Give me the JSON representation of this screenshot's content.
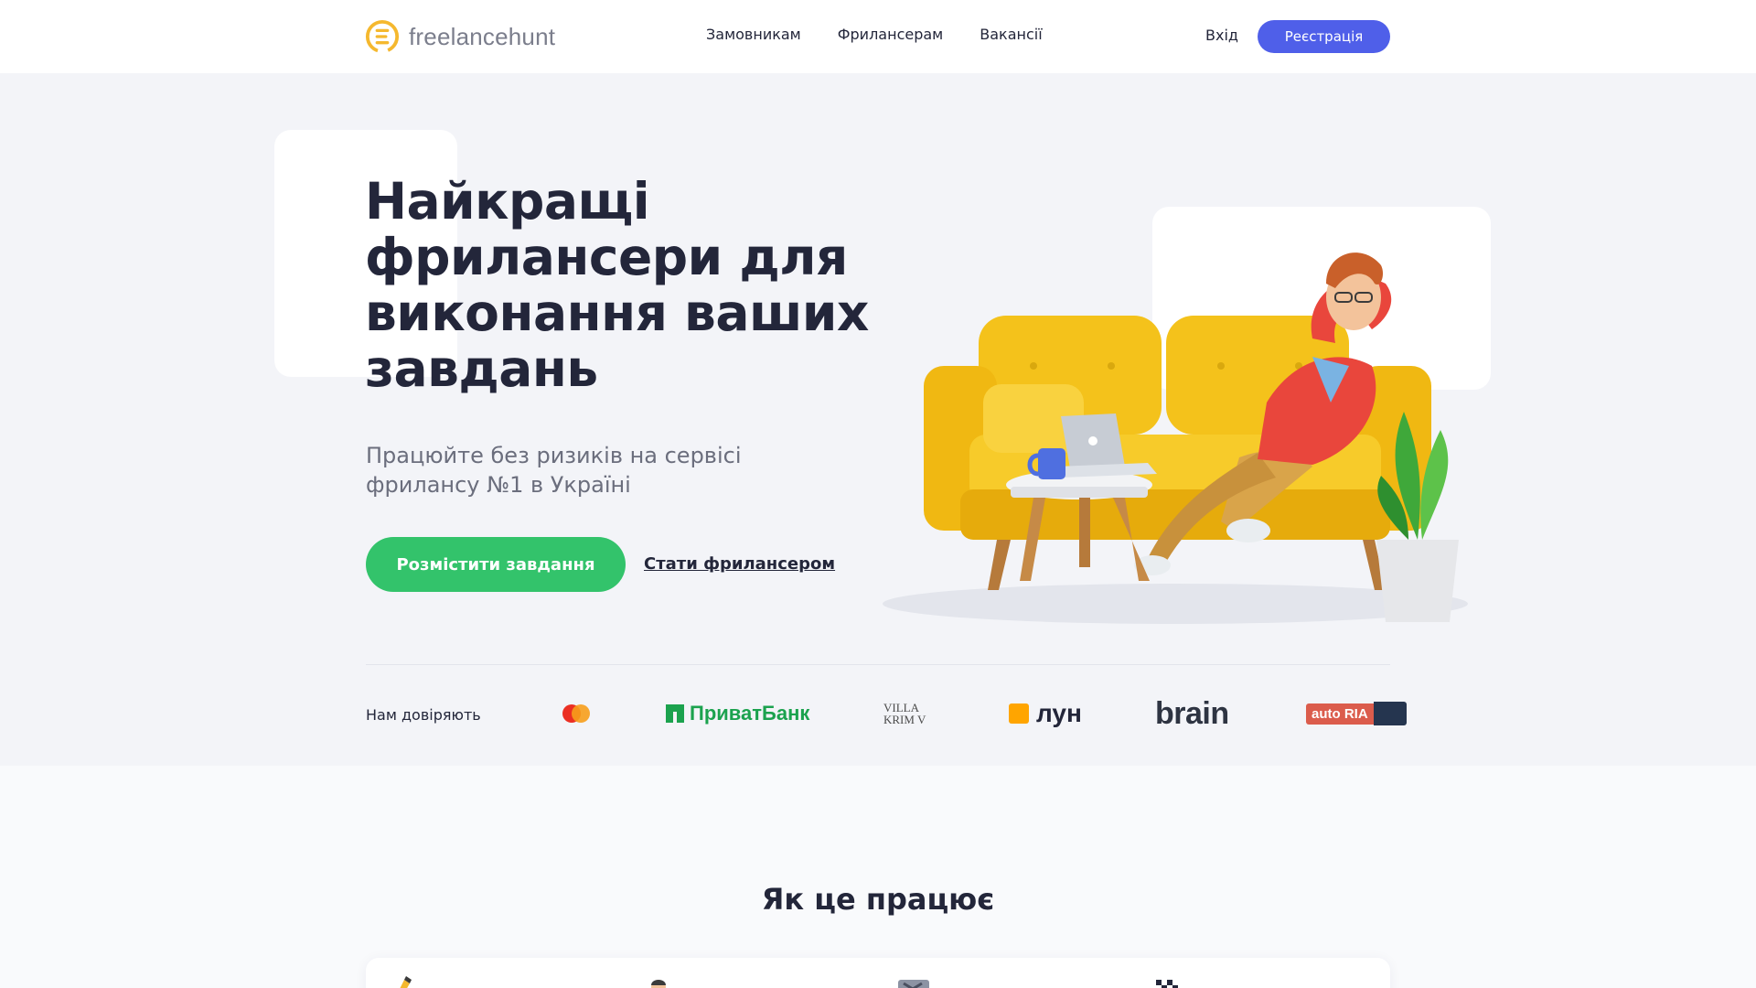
{
  "header": {
    "logo_text": "freelancehunt",
    "nav": [
      "Замовникам",
      "Фрилансерам",
      "Вакансії"
    ],
    "login_label": "Вхід",
    "register_label": "Реєстрація"
  },
  "hero": {
    "title": "Найкращі фрилансери для виконання ваших завдань",
    "subtitle": "Працюйте без ризиків на сервісі фрилансу №1 в Україні",
    "primary_button": "Розмістити завдання",
    "secondary_link": "Стати фрилансером"
  },
  "trust": {
    "label": "Нам довіряють",
    "logos": [
      {
        "name": "mastercard",
        "text": ""
      },
      {
        "name": "privatbank",
        "text": "ПриватБанк"
      },
      {
        "name": "villa-krim",
        "text": "VILLA KRIM V"
      },
      {
        "name": "lun",
        "text": "лун"
      },
      {
        "name": "brain",
        "text": "brain"
      },
      {
        "name": "autoria",
        "text": "auto RIA"
      }
    ]
  },
  "how": {
    "title": "Як це працює"
  },
  "colors": {
    "accent_blue": "#4f5fe9",
    "accent_green": "#33c36b",
    "logo_yellow": "#f5b82e",
    "text_dark": "#23263a",
    "hero_bg": "#f3f4f8"
  }
}
